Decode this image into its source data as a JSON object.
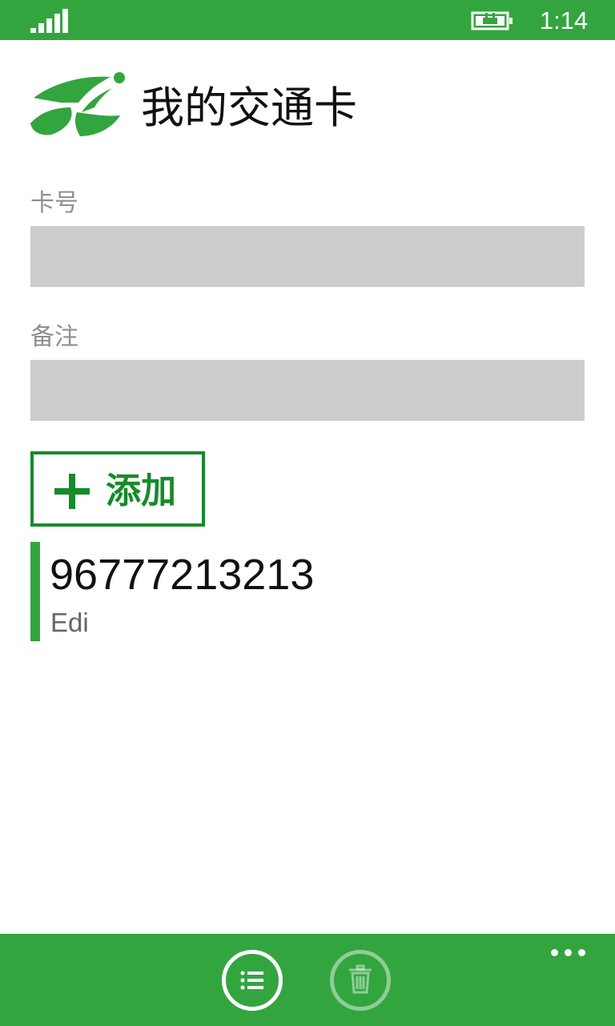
{
  "status_bar": {
    "time": "1:14",
    "icons": [
      "signal-strength-icon",
      "battery-charging-icon"
    ]
  },
  "header": {
    "logo_icon": "running-figure-logo",
    "title": "我的交通卡"
  },
  "form": {
    "card_number_label": "卡号",
    "card_number_value": "",
    "note_label": "备注",
    "note_value": "",
    "add_button_label": "添加",
    "add_button_icon": "plus-icon"
  },
  "cards": [
    {
      "number": "96777213213",
      "note": "Edi"
    }
  ],
  "app_bar": {
    "buttons": [
      {
        "icon": "list-icon",
        "enabled": true
      },
      {
        "icon": "trash-icon",
        "enabled": false
      }
    ],
    "more_icon": "ellipsis-icon"
  },
  "colors": {
    "accent": "#33a53f",
    "button_green": "#168b2a",
    "field_background": "#cccccc",
    "label_gray": "#8f8f8f"
  }
}
